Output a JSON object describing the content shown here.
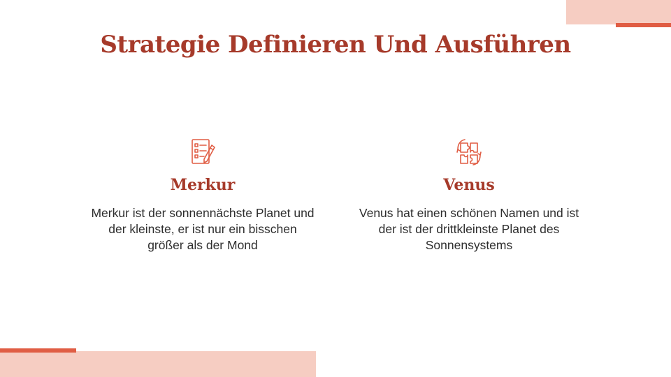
{
  "slide": {
    "title": "Strategie Definieren Und Ausführen"
  },
  "cards": [
    {
      "icon": "checklist-pencil-icon",
      "heading": "Merkur",
      "text": "Merkur ist der sonnennächste Planet und der kleinste, er ist nur ein bisschen größer als der Mond"
    },
    {
      "icon": "puzzle-hands-icon",
      "heading": "Venus",
      "text": "Venus hat einen schönen Namen und ist der ist der drittkleinste Planet des Sonnensystems"
    }
  ],
  "colors": {
    "accent": "#a63a2a",
    "accent_line": "#e05d44",
    "accent_light": "#f6cdc2",
    "text": "#2e2e2e"
  }
}
